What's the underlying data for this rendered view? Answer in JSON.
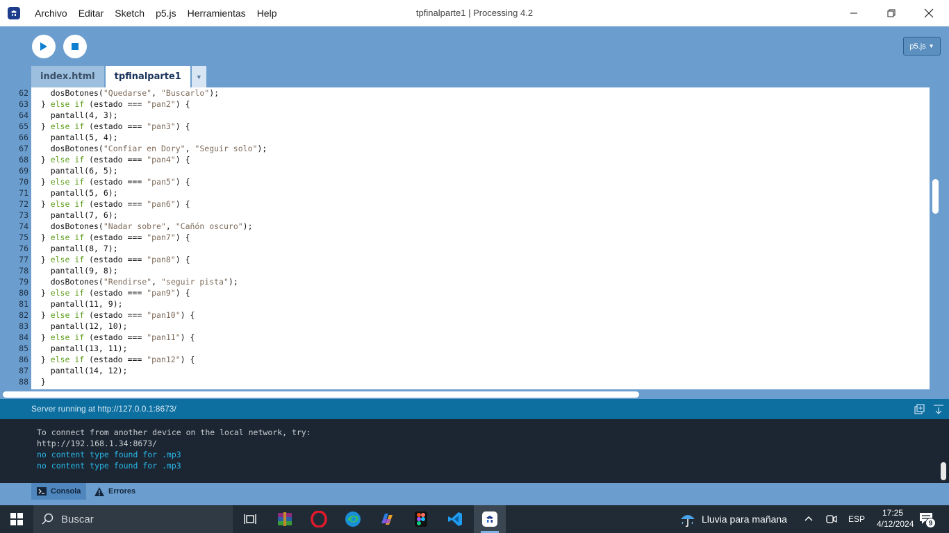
{
  "window": {
    "title": "tpfinalparte1 | Processing 4.2",
    "menu": [
      "Archivo",
      "Editar",
      "Sketch",
      "p5.js",
      "Herramientas",
      "Help"
    ]
  },
  "toolbar": {
    "mode_label": "p5.js"
  },
  "tabs": [
    "index.html",
    "tpfinalparte1"
  ],
  "editor": {
    "lines": [
      {
        "n": "62",
        "segs": [
          {
            "t": "    dosBotones(",
            "c": ""
          },
          {
            "t": "\"Quedarse\"",
            "c": "str"
          },
          {
            "t": ", ",
            "c": ""
          },
          {
            "t": "\"Buscarlo\"",
            "c": "str"
          },
          {
            "t": ");",
            "c": ""
          }
        ]
      },
      {
        "n": "63",
        "segs": [
          {
            "t": "  } ",
            "c": ""
          },
          {
            "t": "else if",
            "c": "kw"
          },
          {
            "t": " (estado === ",
            "c": ""
          },
          {
            "t": "\"pan2\"",
            "c": "str"
          },
          {
            "t": ") {",
            "c": ""
          }
        ]
      },
      {
        "n": "64",
        "segs": [
          {
            "t": "    pantall(4, 3);",
            "c": ""
          }
        ]
      },
      {
        "n": "65",
        "segs": [
          {
            "t": "  } ",
            "c": ""
          },
          {
            "t": "else if",
            "c": "kw"
          },
          {
            "t": " (estado === ",
            "c": ""
          },
          {
            "t": "\"pan3\"",
            "c": "str"
          },
          {
            "t": ") {",
            "c": ""
          }
        ]
      },
      {
        "n": "66",
        "segs": [
          {
            "t": "    pantall(5, 4);",
            "c": ""
          }
        ]
      },
      {
        "n": "67",
        "segs": [
          {
            "t": "    dosBotones(",
            "c": ""
          },
          {
            "t": "\"Confiar en Dory\"",
            "c": "str"
          },
          {
            "t": ", ",
            "c": ""
          },
          {
            "t": "\"Seguir solo\"",
            "c": "str"
          },
          {
            "t": ");",
            "c": ""
          }
        ]
      },
      {
        "n": "68",
        "segs": [
          {
            "t": "  } ",
            "c": ""
          },
          {
            "t": "else if",
            "c": "kw"
          },
          {
            "t": " (estado === ",
            "c": ""
          },
          {
            "t": "\"pan4\"",
            "c": "str"
          },
          {
            "t": ") {",
            "c": ""
          }
        ]
      },
      {
        "n": "69",
        "segs": [
          {
            "t": "    pantall(6, 5);",
            "c": ""
          }
        ]
      },
      {
        "n": "70",
        "segs": [
          {
            "t": "  } ",
            "c": ""
          },
          {
            "t": "else if",
            "c": "kw"
          },
          {
            "t": " (estado === ",
            "c": ""
          },
          {
            "t": "\"pan5\"",
            "c": "str"
          },
          {
            "t": ") {",
            "c": ""
          }
        ]
      },
      {
        "n": "71",
        "segs": [
          {
            "t": "    pantall(5, 6);",
            "c": ""
          }
        ]
      },
      {
        "n": "72",
        "segs": [
          {
            "t": "  } ",
            "c": ""
          },
          {
            "t": "else if",
            "c": "kw"
          },
          {
            "t": " (estado === ",
            "c": ""
          },
          {
            "t": "\"pan6\"",
            "c": "str"
          },
          {
            "t": ") {",
            "c": ""
          }
        ]
      },
      {
        "n": "73",
        "segs": [
          {
            "t": "    pantall(7, 6);",
            "c": ""
          }
        ]
      },
      {
        "n": "74",
        "segs": [
          {
            "t": "    dosBotones(",
            "c": ""
          },
          {
            "t": "\"Nadar sobre\"",
            "c": "str"
          },
          {
            "t": ", ",
            "c": ""
          },
          {
            "t": "\"Cañón oscuro\"",
            "c": "str"
          },
          {
            "t": ");",
            "c": ""
          }
        ]
      },
      {
        "n": "75",
        "segs": [
          {
            "t": "  } ",
            "c": ""
          },
          {
            "t": "else if",
            "c": "kw"
          },
          {
            "t": " (estado === ",
            "c": ""
          },
          {
            "t": "\"pan7\"",
            "c": "str"
          },
          {
            "t": ") {",
            "c": ""
          }
        ]
      },
      {
        "n": "76",
        "segs": [
          {
            "t": "    pantall(8, 7);",
            "c": ""
          }
        ]
      },
      {
        "n": "77",
        "segs": [
          {
            "t": "  } ",
            "c": ""
          },
          {
            "t": "else if",
            "c": "kw"
          },
          {
            "t": " (estado === ",
            "c": ""
          },
          {
            "t": "\"pan8\"",
            "c": "str"
          },
          {
            "t": ") {",
            "c": ""
          }
        ]
      },
      {
        "n": "78",
        "segs": [
          {
            "t": "    pantall(9, 8);",
            "c": ""
          }
        ]
      },
      {
        "n": "79",
        "segs": [
          {
            "t": "    dosBotones(",
            "c": ""
          },
          {
            "t": "\"Rendirse\"",
            "c": "str"
          },
          {
            "t": ", ",
            "c": ""
          },
          {
            "t": "\"seguir pista\"",
            "c": "str"
          },
          {
            "t": ");",
            "c": ""
          }
        ]
      },
      {
        "n": "80",
        "segs": [
          {
            "t": "  } ",
            "c": ""
          },
          {
            "t": "else if",
            "c": "kw"
          },
          {
            "t": " (estado === ",
            "c": ""
          },
          {
            "t": "\"pan9\"",
            "c": "str"
          },
          {
            "t": ") {",
            "c": ""
          }
        ]
      },
      {
        "n": "81",
        "segs": [
          {
            "t": "    pantall(11, 9);",
            "c": ""
          }
        ]
      },
      {
        "n": "82",
        "segs": [
          {
            "t": "  } ",
            "c": ""
          },
          {
            "t": "else if",
            "c": "kw"
          },
          {
            "t": " (estado === ",
            "c": ""
          },
          {
            "t": "\"pan10\"",
            "c": "str"
          },
          {
            "t": ") {",
            "c": ""
          }
        ]
      },
      {
        "n": "83",
        "segs": [
          {
            "t": "    pantall(12, 10);",
            "c": ""
          }
        ]
      },
      {
        "n": "84",
        "segs": [
          {
            "t": "  } ",
            "c": ""
          },
          {
            "t": "else if",
            "c": "kw"
          },
          {
            "t": " (estado === ",
            "c": ""
          },
          {
            "t": "\"pan11\"",
            "c": "str"
          },
          {
            "t": ") {",
            "c": ""
          }
        ]
      },
      {
        "n": "85",
        "segs": [
          {
            "t": "    pantall(13, 11);",
            "c": ""
          }
        ]
      },
      {
        "n": "86",
        "segs": [
          {
            "t": "  } ",
            "c": ""
          },
          {
            "t": "else if",
            "c": "kw"
          },
          {
            "t": " (estado === ",
            "c": ""
          },
          {
            "t": "\"pan12\"",
            "c": "str"
          },
          {
            "t": ") {",
            "c": ""
          }
        ]
      },
      {
        "n": "87",
        "segs": [
          {
            "t": "    pantall(14, 12);",
            "c": ""
          }
        ]
      },
      {
        "n": "88",
        "segs": [
          {
            "t": "  }",
            "c": ""
          }
        ]
      }
    ]
  },
  "status": {
    "text": "Server running at http://127.0.0.1:8673/"
  },
  "console": {
    "lines": [
      {
        "text": "To connect from another device on the local network, try:",
        "color": "#c8ccd0"
      },
      {
        "text": "http://192.168.1.34:8673/",
        "color": "#c8ccd0"
      },
      {
        "text": "no content type found for .mp3",
        "color": "#29b6e8"
      },
      {
        "text": "no content type found for .mp3",
        "color": "#29b6e8"
      }
    ]
  },
  "console_tabs": {
    "console_label": "Consola",
    "errors_label": "Errores"
  },
  "taskbar": {
    "search_label": "Buscar",
    "weather_text": "Lluvia para mañana",
    "language": "ESP",
    "time": "17:25",
    "date": "4/12/2024",
    "notification_count": "9"
  },
  "colors": {
    "editor_bg": "#6b9ece",
    "status_bg": "#0c6fa0",
    "console_bg": "#1c2632",
    "keyword": "#5e9e1c",
    "string": "#7d6a5a"
  }
}
